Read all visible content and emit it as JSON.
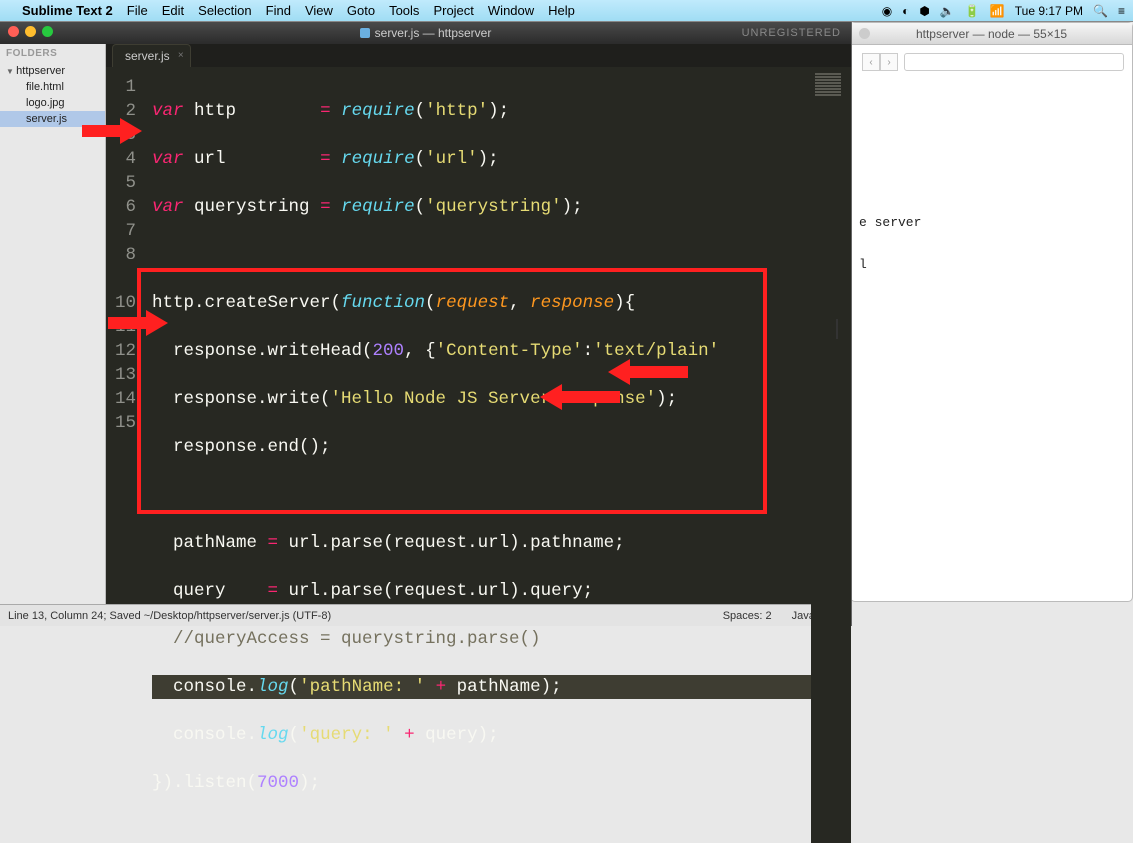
{
  "menubar": {
    "app": "Sublime Text 2",
    "items": [
      "File",
      "Edit",
      "Selection",
      "Find",
      "View",
      "Goto",
      "Tools",
      "Project",
      "Window",
      "Help"
    ],
    "clock": "Tue 9:17 PM"
  },
  "terminal": {
    "title": "httpserver — node — 55×15",
    "line1": "e server",
    "line2": "l"
  },
  "sublime": {
    "title": "server.js — httpserver",
    "unregistered": "UNREGISTERED",
    "sidebar": {
      "header": "FOLDERS",
      "folder": "httpserver",
      "files": [
        "file.html",
        "logo.jpg",
        "server.js"
      ],
      "selected": "server.js"
    },
    "tab": "server.js",
    "lines": [
      "1",
      "2",
      "3",
      "4",
      "5",
      "6",
      "7",
      "8",
      "",
      "10",
      "11",
      "12",
      "13",
      "14",
      "15"
    ],
    "status_left": "Line 13, Column 24; Saved ~/Desktop/httpserver/server.js (UTF-8)",
    "status_spaces": "Spaces: 2",
    "status_lang": "JavaScript"
  },
  "code": {
    "l1_kw": "var",
    "l1_v": "http",
    "l1_eq": "=",
    "l1_fn": "require",
    "l1_p": "(",
    "l1_s": "'http'",
    "l1_e": ");",
    "l2_kw": "var",
    "l2_v": "url",
    "l2_eq": "=",
    "l2_fn": "require",
    "l2_p": "(",
    "l2_s": "'url'",
    "l2_e": ");",
    "l3_kw": "var",
    "l3_v": "querystring",
    "l3_eq": "=",
    "l3_fn": "require",
    "l3_p": "(",
    "l3_s": "'querystring'",
    "l3_e": ");",
    "l5a": "http.createServer(",
    "l5_fn": "function",
    "l5b": "(",
    "l5p1": "request",
    "l5c": ", ",
    "l5p2": "response",
    "l5d": "){",
    "l6a": "  response.writeHead(",
    "l6n": "200",
    "l6b": ", {",
    "l6s1": "'Content-Type'",
    "l6c": ":",
    "l6s2": "'text/plain'",
    "l7a": "  response.write(",
    "l7s": "'Hello Node JS Server Response'",
    "l7b": ");",
    "l8a": "  response.end();",
    "l10a": "  pathName ",
    "l10eq": "=",
    "l10b": " url.parse(request.url).",
    "l10c": "pathname",
    "l10d": ";",
    "l11a": "  query    ",
    "l11eq": "=",
    "l11b": " url.parse(request.url).",
    "l11c": "query",
    "l11d": ";",
    "l12": "  //queryAccess = querystring.parse()",
    "l13a": "  console.",
    "l13fn": "log",
    "l13b": "(",
    "l13s": "'pathName: '",
    "l13c": " ",
    "l13op": "+",
    "l13d": " pathName);",
    "l14a": "  console.",
    "l14fn": "log",
    "l14b": "(",
    "l14s": "'query: '",
    "l14c": " ",
    "l14op": "+",
    "l14d": " query);",
    "l15a": "}).listen(",
    "l15n": "7000",
    "l15b": ");"
  }
}
